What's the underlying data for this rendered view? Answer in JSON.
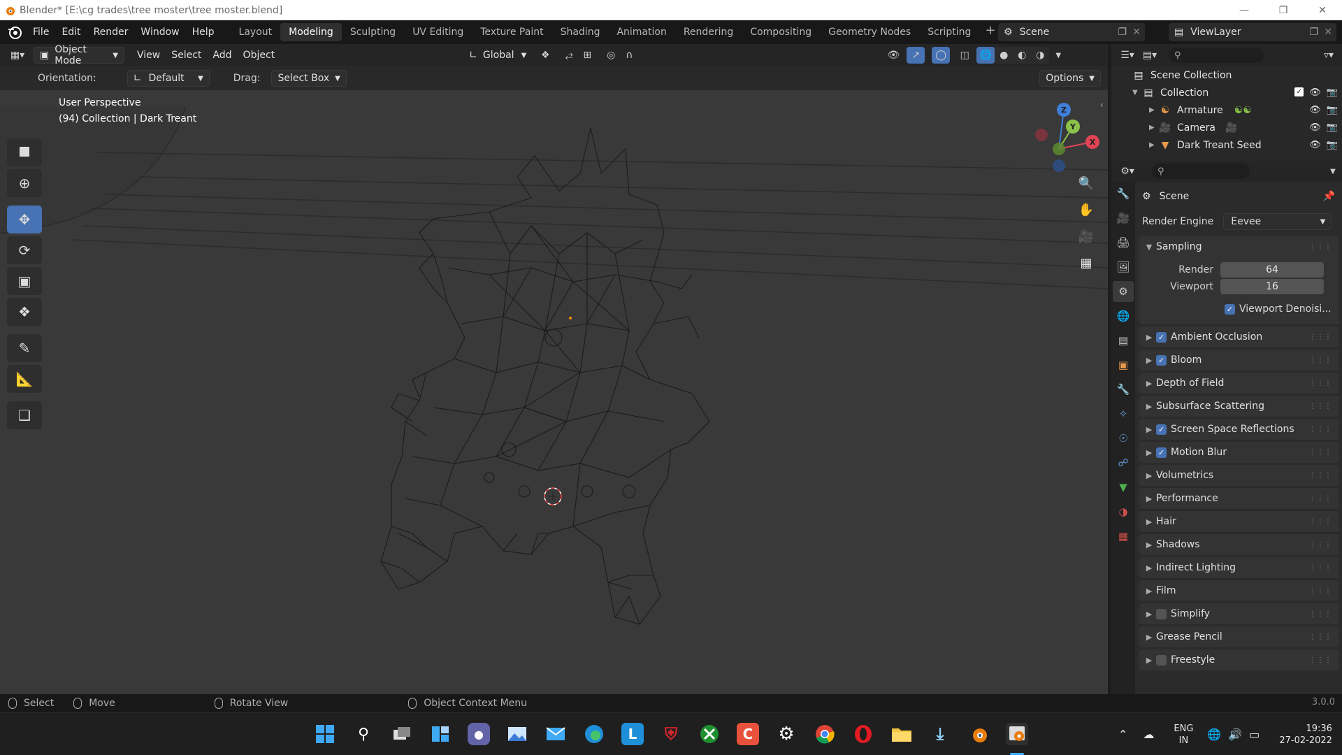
{
  "window": {
    "title": "Blender* [E:\\cg trades\\tree moster\\tree moster.blend]"
  },
  "menu": [
    "File",
    "Edit",
    "Render",
    "Window",
    "Help"
  ],
  "workspaces": [
    "Layout",
    "Modeling",
    "Sculpting",
    "UV Editing",
    "Texture Paint",
    "Shading",
    "Animation",
    "Rendering",
    "Compositing",
    "Geometry Nodes",
    "Scripting"
  ],
  "active_workspace": "Modeling",
  "scene_name": "Scene",
  "view_layer": "ViewLayer",
  "viewport": {
    "mode": "Object Mode",
    "header_menus": [
      "View",
      "Select",
      "Add",
      "Object"
    ],
    "transform_orientation": "Global",
    "orientation_label": "Orientation:",
    "orientation_value": "Default",
    "drag_label": "Drag:",
    "drag_value": "Select Box",
    "options_label": "Options",
    "overlay_line1": "User Perspective",
    "overlay_line2": "(94) Collection | Dark Treant",
    "gizmo_axes": {
      "x": "X",
      "y": "Y",
      "z": "Z"
    }
  },
  "tools": [
    "select-box",
    "cursor",
    "move",
    "rotate",
    "scale",
    "transform",
    "annotate",
    "measure",
    "add-cube"
  ],
  "active_tool": "move",
  "outliner": {
    "root": "Scene Collection",
    "collection": "Collection",
    "items": [
      {
        "label": "Armature",
        "icon": "armature-icon",
        "color": "#e89a4c"
      },
      {
        "label": "Camera",
        "icon": "camera-icon",
        "color": "#e89a4c"
      },
      {
        "label": "Dark Treant Seed",
        "icon": "mesh-icon",
        "color": "#e89a4c"
      }
    ]
  },
  "properties": {
    "context": "Scene",
    "render_engine_label": "Render Engine",
    "render_engine": "Eevee",
    "sampling": {
      "title": "Sampling",
      "render_label": "Render",
      "render_value": "64",
      "viewport_label": "Viewport",
      "viewport_value": "16",
      "denoise_label": "Viewport Denoisi..."
    },
    "panels": [
      {
        "label": "Ambient Occlusion",
        "checkbox": true,
        "checked": true
      },
      {
        "label": "Bloom",
        "checkbox": true,
        "checked": true
      },
      {
        "label": "Depth of Field",
        "checkbox": false,
        "checked": false
      },
      {
        "label": "Subsurface Scattering",
        "checkbox": false,
        "checked": false
      },
      {
        "label": "Screen Space Reflections",
        "checkbox": true,
        "checked": true
      },
      {
        "label": "Motion Blur",
        "checkbox": true,
        "checked": true
      },
      {
        "label": "Volumetrics",
        "checkbox": false,
        "checked": false
      },
      {
        "label": "Performance",
        "checkbox": false,
        "checked": false
      },
      {
        "label": "Hair",
        "checkbox": false,
        "checked": false
      },
      {
        "label": "Shadows",
        "checkbox": false,
        "checked": false
      },
      {
        "label": "Indirect Lighting",
        "checkbox": false,
        "checked": false
      },
      {
        "label": "Film",
        "checkbox": false,
        "checked": false
      },
      {
        "label": "Simplify",
        "checkbox": true,
        "checked": false
      },
      {
        "label": "Grease Pencil",
        "checkbox": false,
        "checked": false
      },
      {
        "label": "Freestyle",
        "checkbox": true,
        "checked": false
      }
    ]
  },
  "status": {
    "select": "Select",
    "move": "Move",
    "rotate": "Rotate View",
    "context_menu": "Object Context Menu",
    "version": "3.0.0"
  },
  "taskbar": {
    "lang1": "ENG",
    "lang2": "IN",
    "time": "19:36",
    "date": "27-02-2022"
  },
  "colors": {
    "accent": "#4772b3",
    "object_orange": "#e89a4c",
    "x_axis": "#e04454",
    "y_axis": "#8bc34a",
    "z_axis": "#3f7fd8"
  }
}
